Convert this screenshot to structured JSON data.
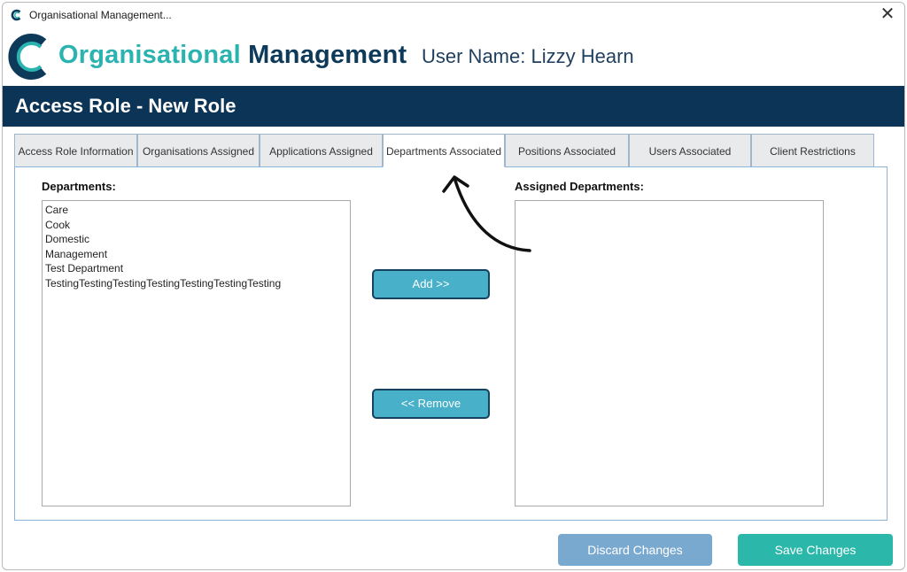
{
  "window": {
    "title": "Organisational Management...",
    "close_symbol": "✕"
  },
  "brand": {
    "name_part1": "Organisational",
    "name_part2": "Management",
    "user_label": "User Name: Lizzy Hearn"
  },
  "page": {
    "heading": "Access Role - New Role"
  },
  "tabs": [
    {
      "label": "Access Role Information"
    },
    {
      "label": "Organisations Assigned"
    },
    {
      "label": "Applications Assigned"
    },
    {
      "label": "Departments Associated",
      "active": true
    },
    {
      "label": "Positions Associated"
    },
    {
      "label": "Users Associated"
    },
    {
      "label": "Client Restrictions"
    }
  ],
  "departments": {
    "label": "Departments:",
    "items": [
      "Care",
      "Cook",
      "Domestic",
      "Management",
      "Test Department",
      "TestingTestingTestingTestingTestingTestingTesting"
    ]
  },
  "assigned": {
    "label": "Assigned Departments:",
    "items": []
  },
  "actions": {
    "add_label": "Add  >>",
    "remove_label": "<< Remove"
  },
  "footer": {
    "discard_label": "Discard Changes",
    "save_label": "Save Changes"
  },
  "colors": {
    "brand_teal": "#2bb3b0",
    "brand_navy": "#0e3a5a",
    "banner": "#0c3456",
    "action_button": "#48b0c8",
    "discard_button": "#7aa9cf",
    "save_button": "#2bb7aa"
  }
}
